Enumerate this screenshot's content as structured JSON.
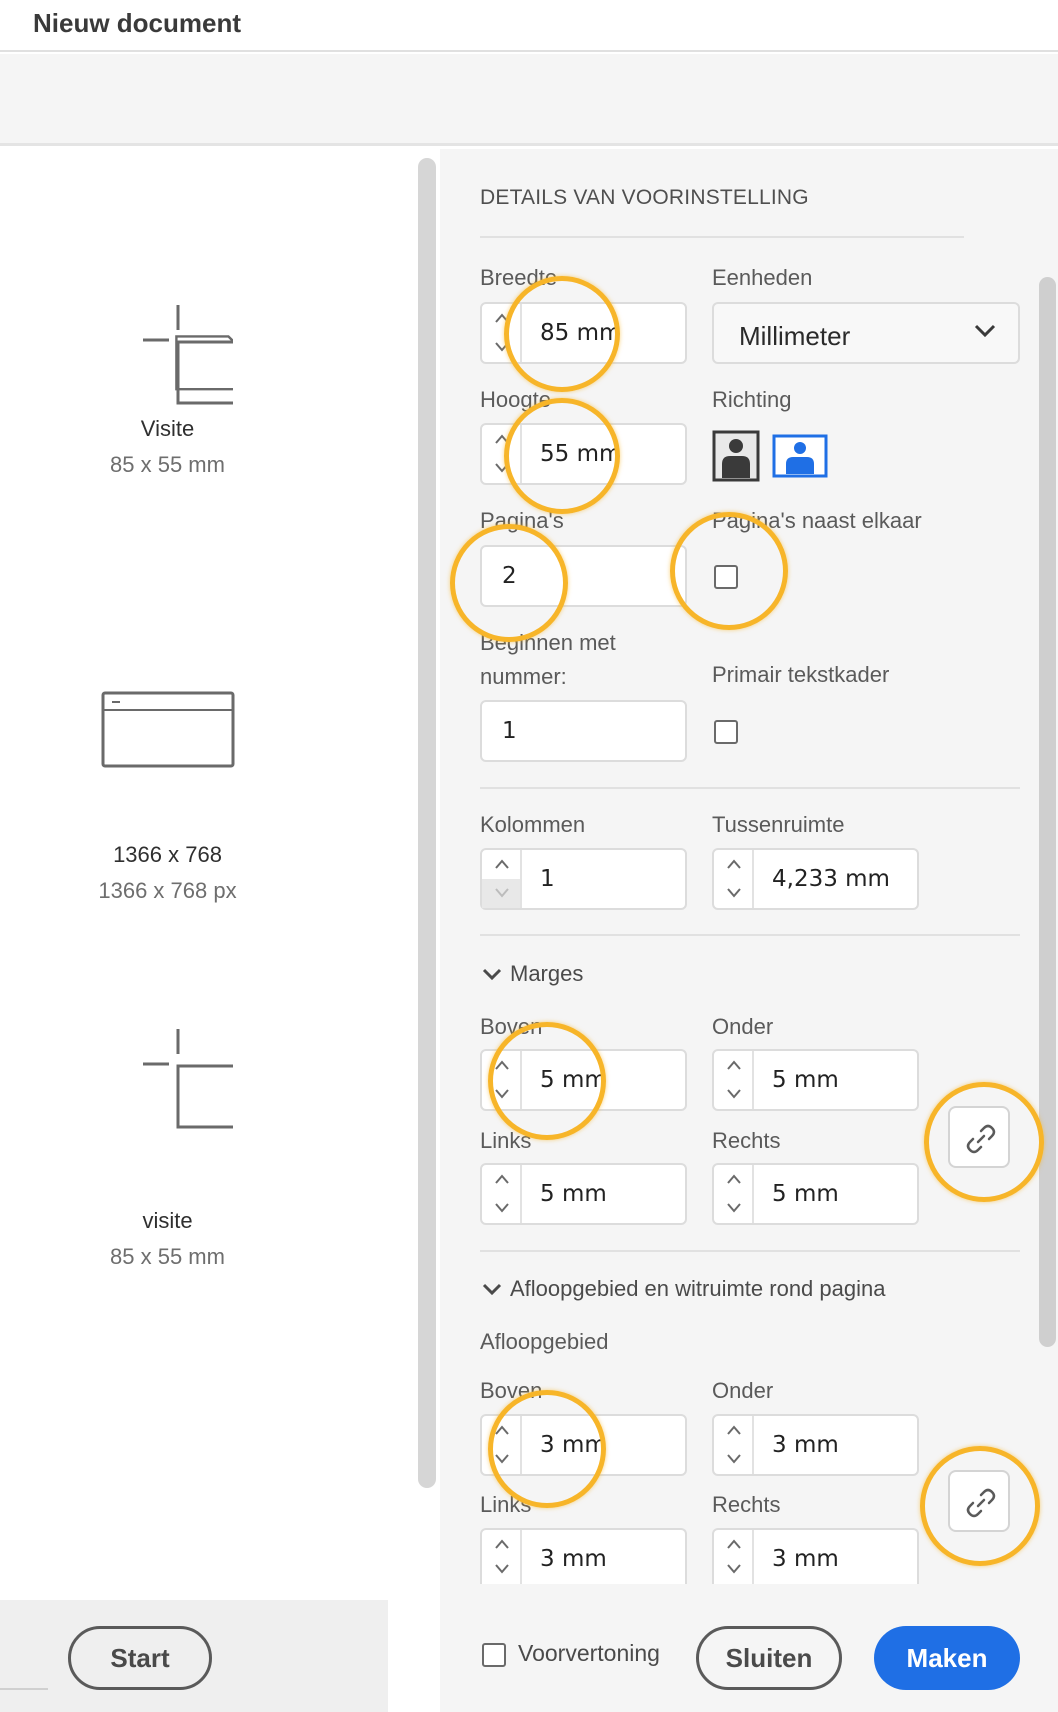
{
  "window": {
    "title": "Nieuw document"
  },
  "presets": [
    {
      "name": "Visite",
      "size": "85 x 55 mm",
      "icon": "document-icon"
    },
    {
      "name": "1366 x 768",
      "size": "1366 x 768 px",
      "icon": "web-icon"
    },
    {
      "name": "visite",
      "size": "85 x 55 mm",
      "icon": "document-icon"
    }
  ],
  "details": {
    "section_title": "DETAILS VAN VOORINSTELLING",
    "width": {
      "label": "Breedte",
      "value": "85 mm"
    },
    "units": {
      "label": "Eenheden",
      "value": "Millimeter"
    },
    "height": {
      "label": "Hoogte",
      "value": "55 mm"
    },
    "orientation": {
      "label": "Richting",
      "selected": "landscape"
    },
    "pages": {
      "label": "Pagina's",
      "value": "2"
    },
    "facing_pages": {
      "label": "Pagina's naast elkaar",
      "checked": false
    },
    "start_number": {
      "label_line1": "Beginnen met",
      "label_line2": "nummer:",
      "value": "1"
    },
    "primary_text_frame": {
      "label": "Primair tekstkader",
      "checked": false
    },
    "columns": {
      "label": "Kolommen",
      "value": "1"
    },
    "gutter": {
      "label": "Tussenruimte",
      "value": "4,233 mm"
    }
  },
  "margins": {
    "title": "Marges",
    "top": {
      "label": "Boven",
      "value": "5 mm"
    },
    "bottom": {
      "label": "Onder",
      "value": "5 mm"
    },
    "left": {
      "label": "Links",
      "value": "5 mm"
    },
    "right": {
      "label": "Rechts",
      "value": "5 mm"
    }
  },
  "bleed": {
    "title": "Afloopgebied en witruimte rond pagina",
    "subtitle": "Afloopgebied",
    "top": {
      "label": "Boven",
      "value": "3 mm"
    },
    "bottom": {
      "label": "Onder",
      "value": "3 mm"
    },
    "left": {
      "label": "Links",
      "value": "3 mm"
    },
    "right": {
      "label": "Rechts",
      "value": "3 mm"
    }
  },
  "footer": {
    "start_label": "Start",
    "preview_label": "Voorvertoning",
    "preview_checked": false,
    "close_label": "Sluiten",
    "create_label": "Maken"
  },
  "colors": {
    "accent": "#1f6fe5",
    "highlight_ring": "#f7b529",
    "panel_bg": "#f5f5f5"
  }
}
